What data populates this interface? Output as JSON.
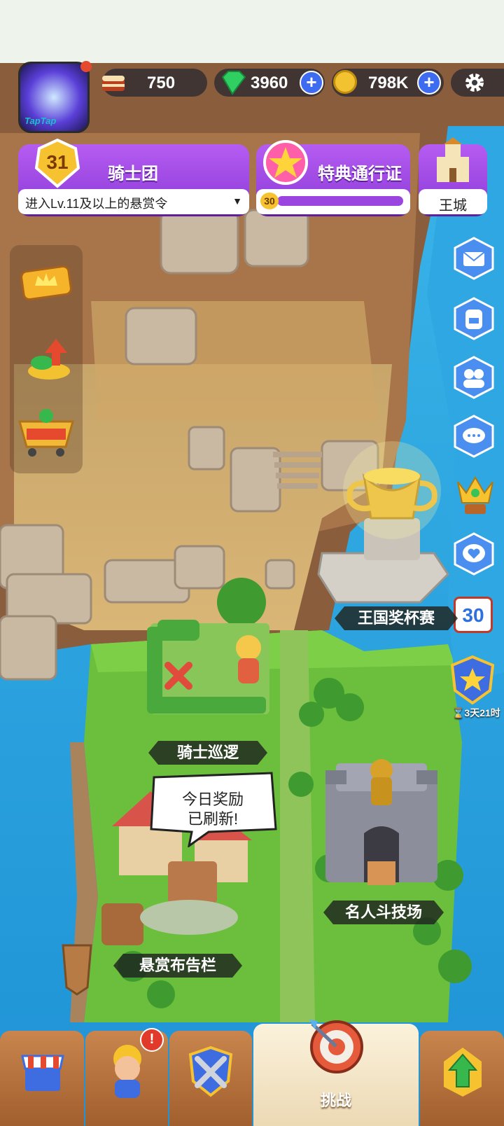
{
  "topbar": {
    "app_badge": "TapTap",
    "cake": "750",
    "gems": "3960",
    "coins": "798K"
  },
  "guild": {
    "level": "31",
    "name": "骑士团",
    "hint": "进入Lv.11及以上的悬赏令"
  },
  "pass": {
    "title": "特典通行证",
    "level": "30"
  },
  "castle": {
    "label": "王城"
  },
  "map_labels": {
    "cup": "王国奖杯赛",
    "patrol": "骑士巡逻",
    "arena": "名人斗技场",
    "board": "悬赏布告栏"
  },
  "speech_bubble": {
    "line1": "今日奖励",
    "line2": "已刷新!"
  },
  "calendar_badge": "30",
  "event_timer": "⌛3天21时",
  "bottom_nav": {
    "challenge": "挑战"
  },
  "colors": {
    "accent_purple": "#9b45e0",
    "plus_blue": "#3e6cf0",
    "sea": "#2aa7e0",
    "grass": "#6cbf3c"
  },
  "icons": [
    "gear-icon",
    "mail-icon",
    "backpack-icon",
    "friends-icon",
    "chat-icon",
    "heart-chat-icon",
    "crown-icon",
    "shop-icon",
    "hero-icon",
    "battle-icon",
    "upgrade-icon",
    "target-icon"
  ]
}
